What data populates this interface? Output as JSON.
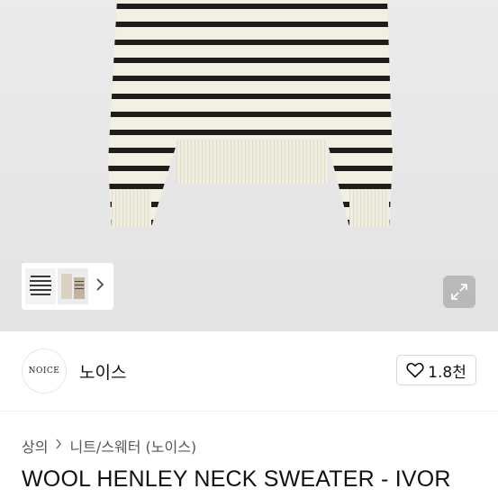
{
  "brand": {
    "logo_text": "NOICE",
    "name": "노이스",
    "like_count": "1.8천"
  },
  "breadcrumb": [
    "상의",
    "니트/스웨터 (노이스)"
  ],
  "product": {
    "title": "WOOL HENLEY NECK SWEATER - IVOR"
  },
  "colors": {
    "stripe": "#1f1d1a",
    "ivory": "#f4efe3",
    "hero_bg": "#e6e6e6"
  },
  "icons": [
    "chevron-right-icon",
    "expand-icon",
    "heart-icon"
  ]
}
